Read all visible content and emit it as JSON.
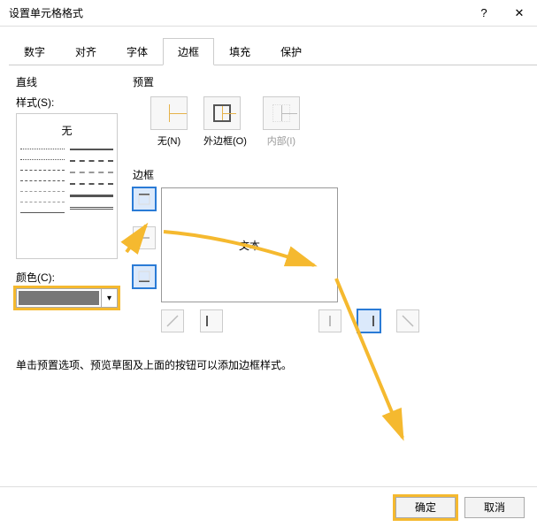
{
  "title": "设置单元格格式",
  "titlebar": {
    "help": "?",
    "close": "✕"
  },
  "tabs": [
    "数字",
    "对齐",
    "字体",
    "边框",
    "填充",
    "保护"
  ],
  "active_tab_index": 3,
  "line": {
    "section": "直线",
    "style_label": "样式(S):",
    "none": "无",
    "color_label": "颜色(C):"
  },
  "preset": {
    "section": "预置",
    "none": "无(N)",
    "outer": "外边框(O)",
    "inner": "内部(I)"
  },
  "border": {
    "section": "边框",
    "preview_text": "文本"
  },
  "hint": "单击预置选项、预览草图及上面的按钮可以添加边框样式。",
  "buttons": {
    "ok": "确定",
    "cancel": "取消"
  }
}
